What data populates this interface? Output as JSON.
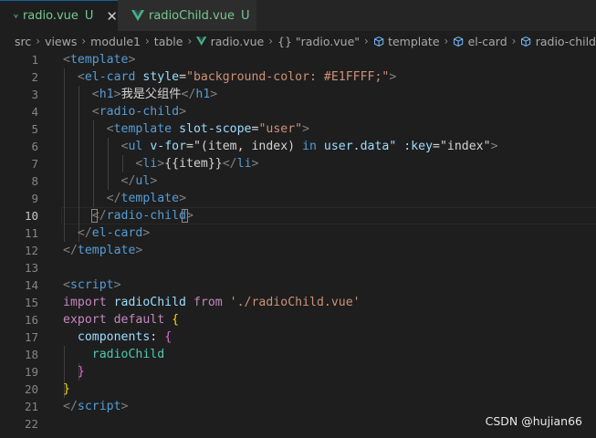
{
  "tabs": [
    {
      "filename": "radio.vue",
      "status": "U",
      "close": "✕"
    },
    {
      "filename": "radioChild.vue",
      "status": "U"
    }
  ],
  "breadcrumb": {
    "items": [
      "src",
      "views",
      "module1",
      "table",
      "radio.vue",
      "{} \"radio.vue\"",
      "template",
      "el-card",
      "radio-child"
    ],
    "separator": "›"
  },
  "editor": {
    "line_numbers": [
      "1",
      "2",
      "3",
      "4",
      "5",
      "6",
      "7",
      "8",
      "9",
      "10",
      "11",
      "12",
      "13",
      "14",
      "15",
      "16",
      "17",
      "18",
      "19",
      "20",
      "21",
      "22"
    ],
    "current_line": "10",
    "tokens": {
      "lt": "<",
      "gt": ">",
      "close_open": "</",
      "eq": "=",
      "template": "template",
      "el_card": "el-card",
      "h1": "h1",
      "radio_child": "radio-child",
      "ul": "ul",
      "li": "li",
      "script": "script",
      "style": "style",
      "style_val": "\"background-color: #E1FFFF;\"",
      "h1_text": "我是父组件",
      "slot_scope": "slot-scope",
      "slot_val": "\"user\"",
      "v_for": "v-for",
      "vfor_q1": "=\"(item, index) ",
      "vfor_in": "in",
      "vfor_data": " user.data\"",
      "key_attr": ":key",
      "key_val": "\"index\"",
      "mustache": "{{item}}",
      "import": "import",
      "radioChild": "radioChild",
      "from": "from",
      "path": "'./radioChild.vue'",
      "export": "export",
      "default": "default",
      "lbrace": "{",
      "rbrace": "}",
      "components": "components",
      "colon_brace": ":"
    }
  },
  "watermark": "CSDN @hujian66",
  "colors": {
    "tab_file": "#73c991",
    "keyword": "#c586c0",
    "tag": "#569cd6",
    "attr": "#9cdcfe",
    "string": "#ce9178",
    "class": "#4ec9b0",
    "brace": "#ffd700"
  },
  "icons": {
    "vue": "vue-logo-icon",
    "braces": "braces-icon",
    "cube": "symbol-cube-icon"
  }
}
